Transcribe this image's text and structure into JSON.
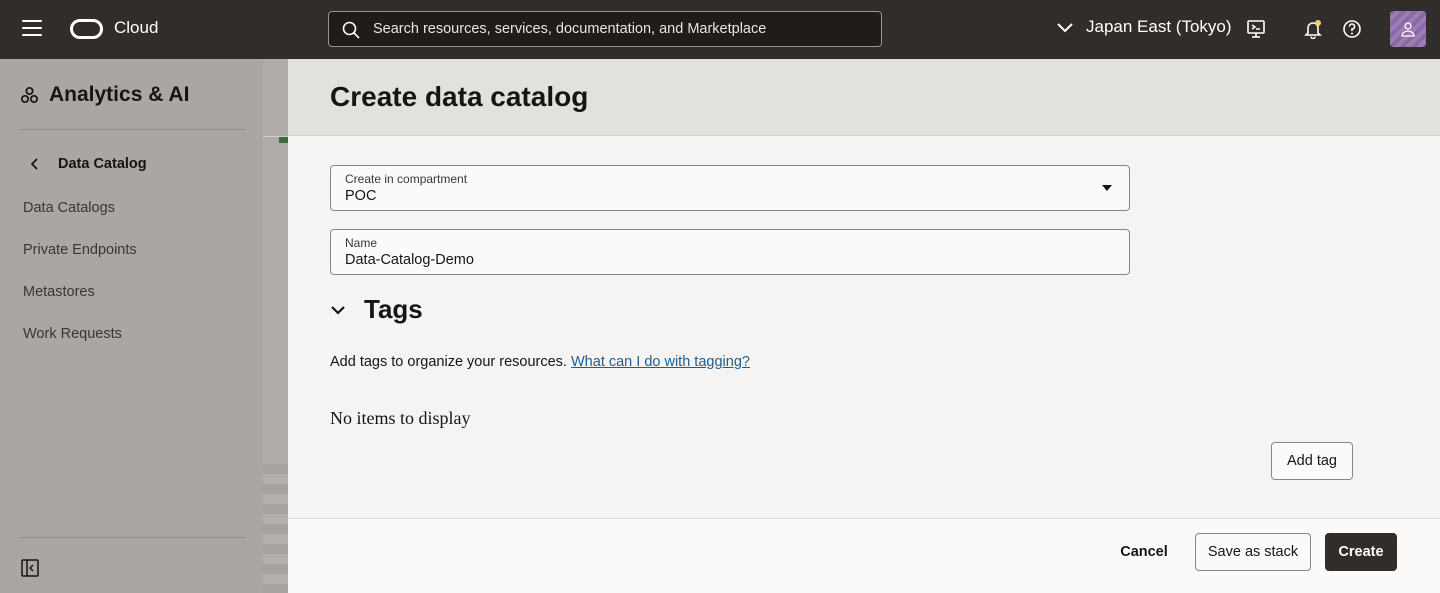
{
  "topbar": {
    "brand": "Cloud",
    "search_placeholder": "Search resources, services, documentation, and Marketplace",
    "region": "Japan East (Tokyo)"
  },
  "sidebar": {
    "title": "Analytics & AI",
    "back_label": "Data Catalog",
    "items": [
      {
        "label": "Data Catalogs"
      },
      {
        "label": "Private Endpoints"
      },
      {
        "label": "Metastores"
      },
      {
        "label": "Work Requests"
      }
    ]
  },
  "panel": {
    "title": "Create data catalog",
    "compartment": {
      "label": "Create in compartment",
      "value": "POC"
    },
    "name": {
      "label": "Name",
      "value": "Data-Catalog-Demo"
    },
    "tags": {
      "title": "Tags",
      "description": "Add tags to organize your resources.",
      "link": "What can I do with tagging?",
      "empty": "No items to display",
      "add_label": "Add tag"
    }
  },
  "footer": {
    "cancel_label": "Cancel",
    "stack_label": "Save as stack",
    "create_label": "Create"
  },
  "colors": {
    "topbar": "#312d2a",
    "link": "#1f5d8f",
    "primary_button": "#312d2a"
  }
}
